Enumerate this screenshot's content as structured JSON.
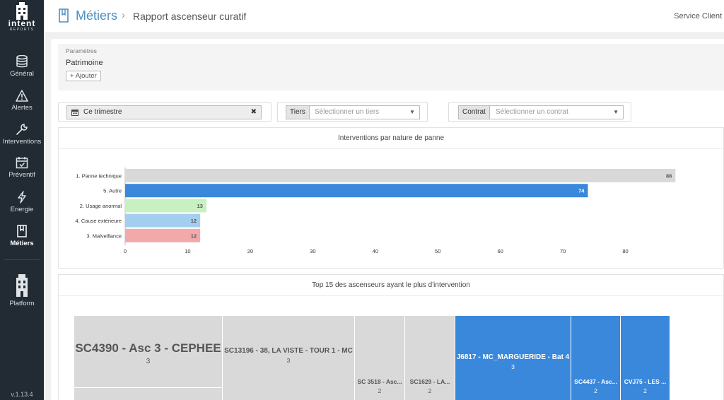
{
  "app": {
    "version": "v.1.13.4",
    "logo_text": "intent",
    "logo_sub": "REPORTS"
  },
  "sidebar": {
    "items": [
      {
        "label": "Général",
        "icon": "database-icon"
      },
      {
        "label": "Alertes",
        "icon": "warning-icon"
      },
      {
        "label": "Interventions",
        "icon": "wrench-icon"
      },
      {
        "label": "Préventif",
        "icon": "calendar-check-icon"
      },
      {
        "label": "Energie",
        "icon": "lightning-icon"
      },
      {
        "label": "Métiers",
        "icon": "book-icon",
        "active": true
      },
      {
        "label": "Platform",
        "icon": "building-icon"
      }
    ]
  },
  "header": {
    "title": "Métiers",
    "separator": "›",
    "subtitle": "Rapport ascenseur curatif",
    "right_link": "Service Client"
  },
  "params": {
    "label": "Paramètres",
    "title": "Patrimoine",
    "add_label": "Ajouter",
    "add_symbol": "+"
  },
  "filters": {
    "date_value": "Ce trimestre",
    "clear_symbol": "✖",
    "tiers_label": "Tiers",
    "tiers_placeholder": "Sélectionner un tiers",
    "contrat_label": "Contrat",
    "contrat_placeholder": "Sélectionner un contrat",
    "arrow": "▼"
  },
  "chart_data": [
    {
      "type": "bar",
      "orientation": "horizontal",
      "title": "Interventions par nature de panne",
      "categories": [
        "1. Panne technique",
        "5. Autre",
        "2. Usage anormal",
        "4. Cause extérieure",
        "3. Malveillance"
      ],
      "values": [
        88,
        74,
        13,
        12,
        12
      ],
      "colors": [
        "#d9d9d9",
        "#3a88dc",
        "#c8f0c0",
        "#a3cef0",
        "#f1a9a9"
      ],
      "label_colors": [
        "#555555",
        "#ffffff",
        "#555555",
        "#555555",
        "#555555"
      ],
      "xticks": [
        0,
        10,
        20,
        30,
        40,
        50,
        60,
        70,
        80
      ],
      "xlim": [
        0,
        90
      ],
      "grid": false,
      "legend": "none"
    },
    {
      "type": "treemap",
      "title": "Top 15 des ascenseurs ayant le plus d'intervention",
      "items": [
        {
          "name": "SC4390 - Asc 3 - CEPHEE",
          "value": 3,
          "color": "#d9d9d9",
          "text_color": "#555555"
        },
        {
          "name": "SC13196 - 38, LA VISTE - TOUR 1 - MC",
          "value": 3,
          "color": "#d9d9d9",
          "text_color": "#555555"
        },
        {
          "name": "SC 3518 - Asc...",
          "value": 2,
          "color": "#d9d9d9",
          "text_color": "#555555"
        },
        {
          "name": "SC1629 - LA...",
          "value": 2,
          "color": "#d9d9d9",
          "text_color": "#555555"
        },
        {
          "name": "J6817 - MC_MARGUERIDE - Bat 4",
          "value": 3,
          "color": "#3a88dc",
          "text_color": "#ffffff"
        },
        {
          "name": "SC4437 - Asc...",
          "value": 2,
          "color": "#3a88dc",
          "text_color": "#ffffff"
        },
        {
          "name": "CVJ75 - LES ...",
          "value": 2,
          "color": "#3a88dc",
          "text_color": "#ffffff"
        }
      ]
    }
  ]
}
